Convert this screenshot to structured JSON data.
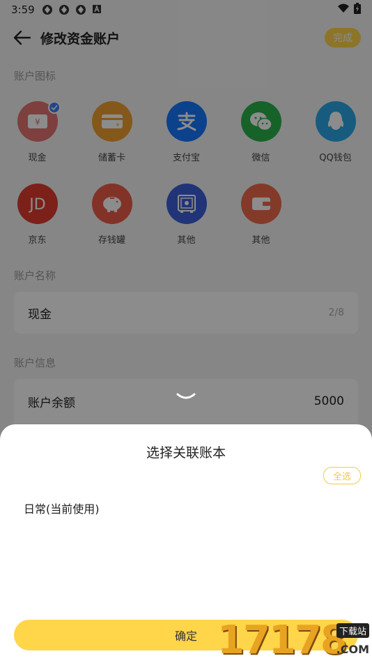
{
  "status_bar": {
    "time": "3:59"
  },
  "header": {
    "title": "修改资金账户",
    "done_label": "完成"
  },
  "sections": {
    "icon_label": "账户图标",
    "name_label": "账户名称",
    "info_label": "账户信息"
  },
  "icons": [
    {
      "label": "现金",
      "color": "#e57373",
      "icon": "cash-icon",
      "selected": true
    },
    {
      "label": "储蓄卡",
      "color": "#f0a030",
      "icon": "debit-card-icon"
    },
    {
      "label": "支付宝",
      "color": "#1677ff",
      "icon": "alipay-icon"
    },
    {
      "label": "微信",
      "color": "#2bb24c",
      "icon": "wechat-icon"
    },
    {
      "label": "QQ钱包",
      "color": "#2aa8e8",
      "icon": "qq-wallet-icon"
    },
    {
      "label": "京东",
      "color": "#e03c31",
      "icon": "jd-icon"
    },
    {
      "label": "存钱罐",
      "color": "#ef5b4a",
      "icon": "piggy-bank-icon"
    },
    {
      "label": "其他",
      "color": "#3d5fd9",
      "icon": "safe-icon"
    },
    {
      "label": "其他",
      "color": "#f06a4a",
      "icon": "wallet-icon"
    }
  ],
  "account_name": {
    "value": "现金",
    "count": "2/8"
  },
  "account_info": {
    "balance_label": "账户余额",
    "balance_value": "5000"
  },
  "sheet": {
    "title": "选择关联账本",
    "select_all": "全选",
    "books": [
      "日常(当前使用)"
    ],
    "confirm_label": "确定"
  },
  "watermark": {
    "number": "17178",
    "tag": "下载站",
    "domain": ".COM"
  }
}
